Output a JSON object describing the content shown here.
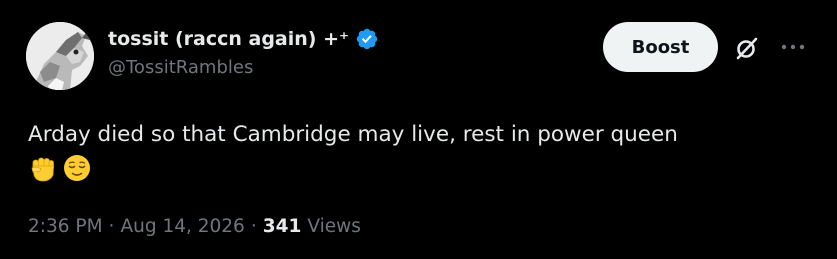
{
  "tweet": {
    "author": {
      "display_name": "tossit (raccn again) +⁺",
      "handle": "@TossitRambles",
      "verified": true,
      "avatar": "raccoon-avatar"
    },
    "actions": {
      "boost_label": "Boost",
      "grok_icon": "slashed-circle-icon",
      "more_icon": "ellipsis-icon"
    },
    "text": "Arday died so that Cambridge may live, rest in power queen",
    "emojis": [
      "raised-fist-icon",
      "relieved-face-icon"
    ],
    "meta": {
      "time": "2:36 PM",
      "separator": "·",
      "date": "Aug 14, 2026",
      "views_count": "341",
      "views_label": "Views"
    },
    "colors": {
      "background": "#000000",
      "text": "#e7e9ea",
      "muted": "#71767b",
      "verified": "#1d9bf0",
      "boost_bg": "#eff3f4"
    }
  }
}
